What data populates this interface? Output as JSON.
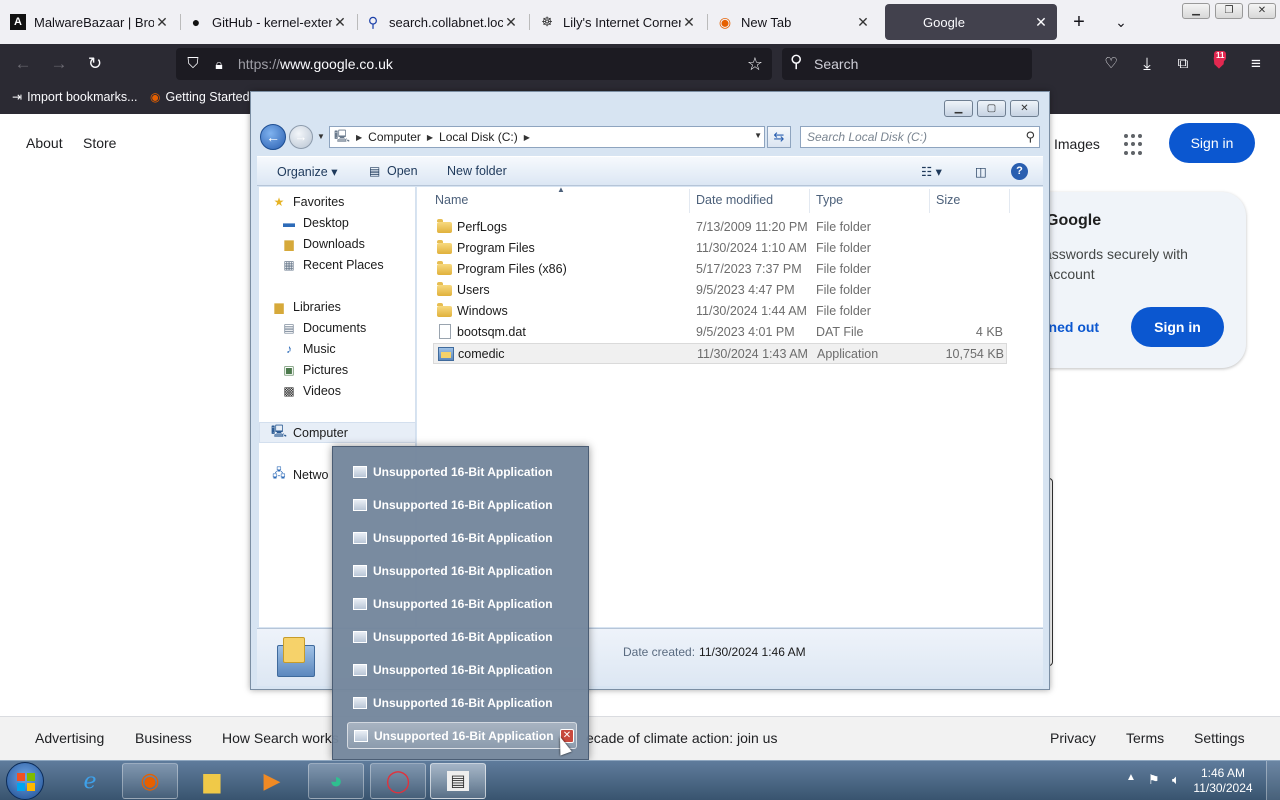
{
  "browser": {
    "tabs": [
      {
        "label": "MalwareBazaar | Brow",
        "icon": "malwarebazaar-icon"
      },
      {
        "label": "GitHub - kernel-exten",
        "icon": "github-icon"
      },
      {
        "label": "search.collabnet.local",
        "icon": "search-icon"
      },
      {
        "label": "Lily's Internet Corner",
        "icon": "tab-site-icon"
      },
      {
        "label": "New Tab",
        "icon": "firefox-icon"
      },
      {
        "label": "Google",
        "icon": "google-icon",
        "active": true
      }
    ],
    "url_proto": "https://",
    "url_host": "www.google.co.uk",
    "search_placeholder": "Search",
    "extension_badge": "11",
    "bookmarks": [
      "Import bookmarks...",
      "Getting Started"
    ]
  },
  "google": {
    "nav_left": [
      "About",
      "Store"
    ],
    "images": "Images",
    "signin": "Sign in",
    "card": {
      "title": "Google",
      "text": "asswords securely with Account",
      "stay_signed_out": "gned out",
      "signin": "Sign in"
    },
    "footer_left": [
      "Advertising",
      "Business",
      "How Search works"
    ],
    "footer_center": "ecade of climate action: join us",
    "footer_right": [
      "Privacy",
      "Terms",
      "Settings"
    ]
  },
  "explorer": {
    "breadcrumb": [
      "Computer",
      "Local Disk (C:)"
    ],
    "search_placeholder": "Search Local Disk (C:)",
    "toolbar": {
      "organize": "Organize ▾",
      "open": "Open",
      "new_folder": "New folder"
    },
    "nav": {
      "favorites": "Favorites",
      "favorite_items": [
        "Desktop",
        "Downloads",
        "Recent Places"
      ],
      "libraries": "Libraries",
      "library_items": [
        "Documents",
        "Music",
        "Pictures",
        "Videos"
      ],
      "computer": "Computer",
      "network": "Netwo"
    },
    "columns": {
      "name": "Name",
      "date": "Date modified",
      "type": "Type",
      "size": "Size"
    },
    "files": [
      {
        "name": "PerfLogs",
        "date": "7/13/2009 11:20 PM",
        "type": "File folder",
        "size": "",
        "kind": "folder"
      },
      {
        "name": "Program Files",
        "date": "11/30/2024 1:10 AM",
        "type": "File folder",
        "size": "",
        "kind": "folder"
      },
      {
        "name": "Program Files (x86)",
        "date": "5/17/2023 7:37 PM",
        "type": "File folder",
        "size": "",
        "kind": "folder"
      },
      {
        "name": "Users",
        "date": "9/5/2023 4:47 PM",
        "type": "File folder",
        "size": "",
        "kind": "folder"
      },
      {
        "name": "Windows",
        "date": "11/30/2024 1:44 AM",
        "type": "File folder",
        "size": "",
        "kind": "folder"
      },
      {
        "name": "bootsqm.dat",
        "date": "9/5/2023 4:01 PM",
        "type": "DAT File",
        "size": "4 KB",
        "kind": "file"
      },
      {
        "name": "comedic",
        "date": "11/30/2024 1:43 AM",
        "type": "Application",
        "size": "10,754 KB",
        "kind": "app",
        "selected": true
      }
    ],
    "details": {
      "label": "Date created:",
      "value": "11/30/2024 1:46 AM"
    }
  },
  "jumplist": {
    "items": [
      "Unsupported 16-Bit Application",
      "Unsupported 16-Bit Application",
      "Unsupported 16-Bit Application",
      "Unsupported 16-Bit Application",
      "Unsupported 16-Bit Application",
      "Unsupported 16-Bit Application",
      "Unsupported 16-Bit Application",
      "Unsupported 16-Bit Application",
      "Unsupported 16-Bit Application"
    ]
  },
  "taskbar": {
    "time": "1:46 AM",
    "date": "11/30/2024"
  }
}
